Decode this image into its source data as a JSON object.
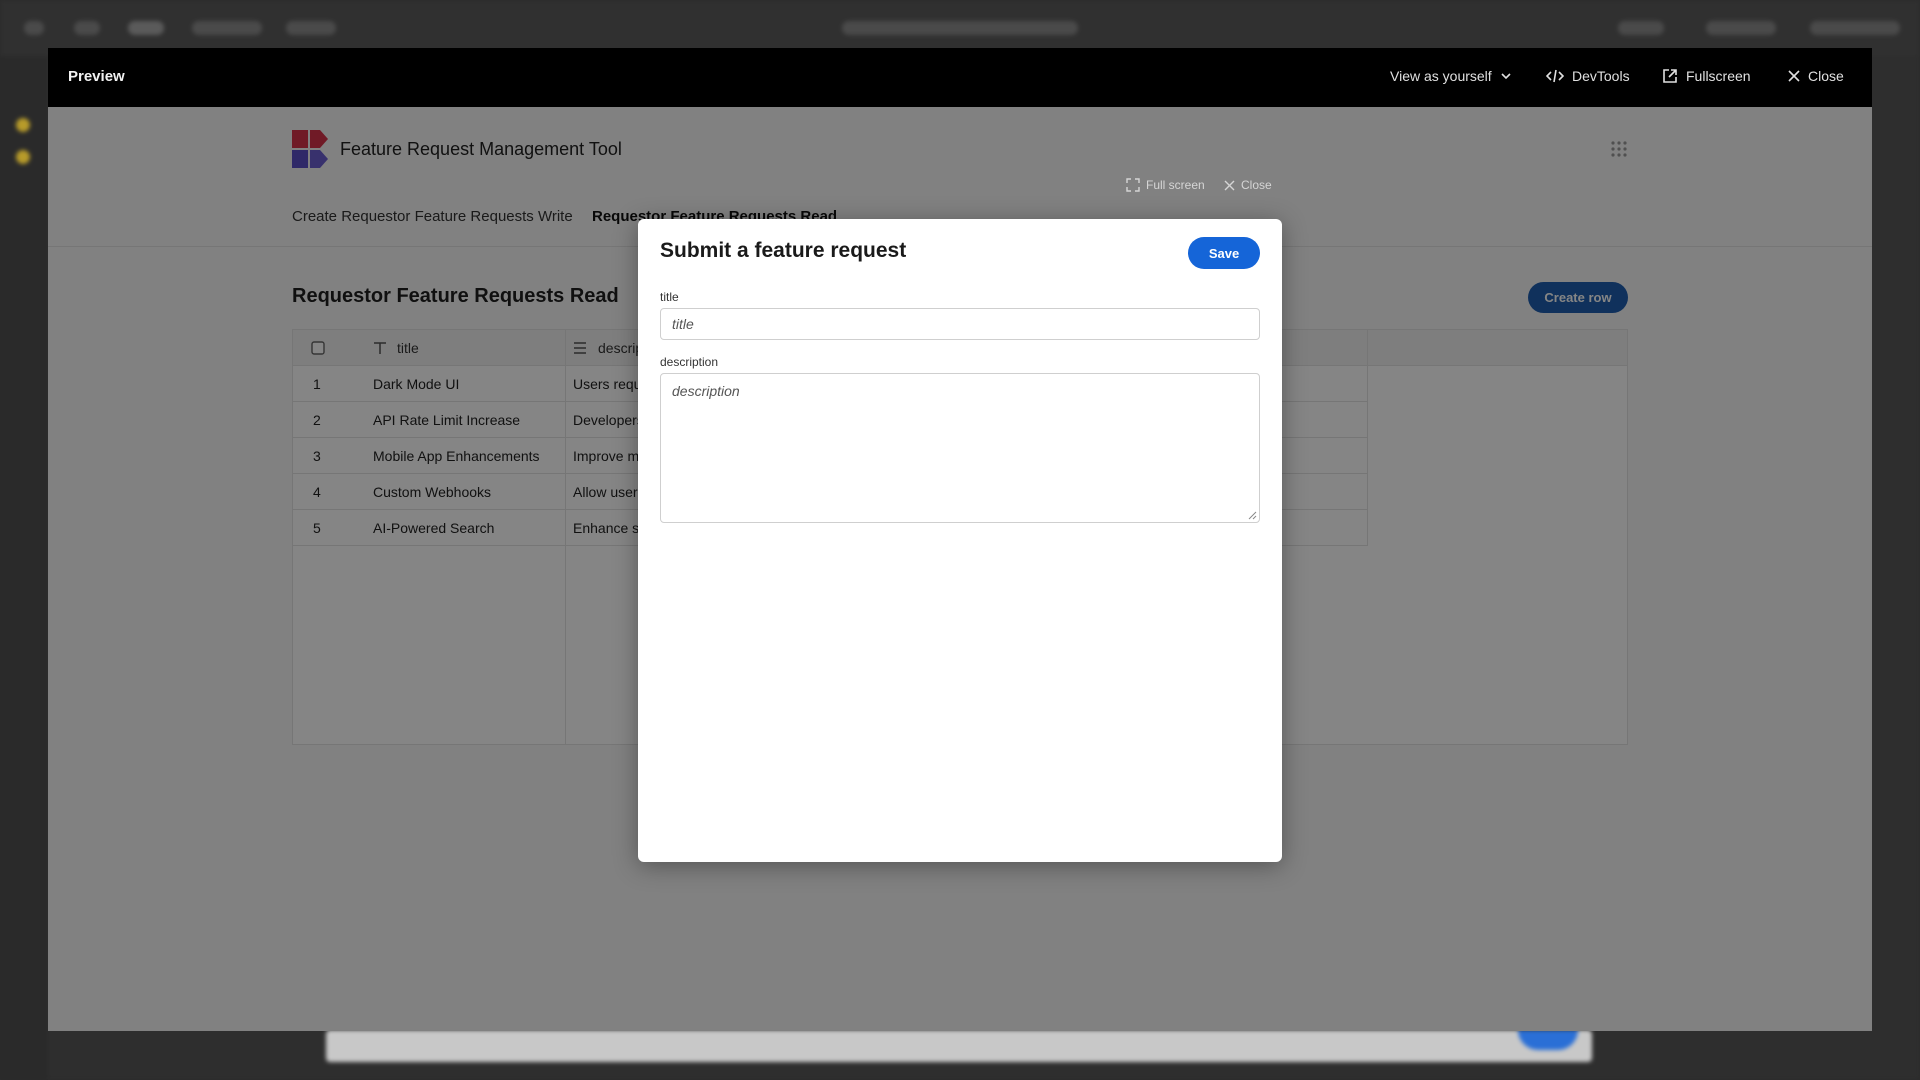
{
  "preview": {
    "title": "Preview",
    "actions": {
      "view_as": "View as yourself",
      "devtools": "DevTools",
      "fullscreen": "Fullscreen",
      "close": "Close"
    }
  },
  "app": {
    "name": "Feature Request Management Tool",
    "nav": [
      {
        "label": "Create Requestor Feature Requests Write",
        "active": false
      },
      {
        "label": "Requestor Feature Requests Read",
        "active": true
      }
    ]
  },
  "table": {
    "title": "Requestor Feature Requests Read",
    "create_label": "Create row",
    "columns": [
      "title",
      "descrip"
    ],
    "rows": [
      {
        "n": "1",
        "title": "Dark Mode UI",
        "description": "Users reque"
      },
      {
        "n": "2",
        "title": "API Rate Limit Increase",
        "description": "Developers"
      },
      {
        "n": "3",
        "title": "Mobile App Enhancements",
        "description": "Improve m"
      },
      {
        "n": "4",
        "title": "Custom Webhooks",
        "description": "Allow users"
      },
      {
        "n": "5",
        "title": "AI-Powered Search",
        "description": "Enhance se"
      }
    ]
  },
  "dialog_tools": {
    "fullscreen": "Full screen",
    "close": "Close"
  },
  "modal": {
    "title": "Submit a feature request",
    "save_label": "Save",
    "fields": {
      "title_label": "title",
      "title_placeholder": "title",
      "description_label": "description",
      "description_placeholder": "description"
    }
  },
  "colors": {
    "primary": "#1565d8",
    "create_button": "#1f5fb0",
    "header": "#000000"
  }
}
